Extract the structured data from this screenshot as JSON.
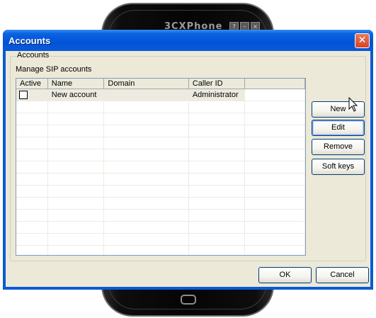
{
  "phone": {
    "title": "3CXPhone"
  },
  "dialog": {
    "title": "Accounts",
    "group_label": "Accounts",
    "description": "Manage SIP accounts",
    "columns": [
      "Active",
      "Name",
      "Domain",
      "Caller ID",
      ""
    ],
    "rows": [
      {
        "active": false,
        "name": "New account",
        "domain": "",
        "caller_id": "Administrator"
      }
    ],
    "side_buttons": {
      "new": "New",
      "edit": "Edit",
      "remove": "Remove",
      "soft_keys": "Soft keys"
    },
    "footer_buttons": {
      "ok": "OK",
      "cancel": "Cancel"
    }
  },
  "colors": {
    "titlebar": "#0252d8",
    "dialog_bg": "#ece9d8",
    "close_button": "#d4442a"
  }
}
